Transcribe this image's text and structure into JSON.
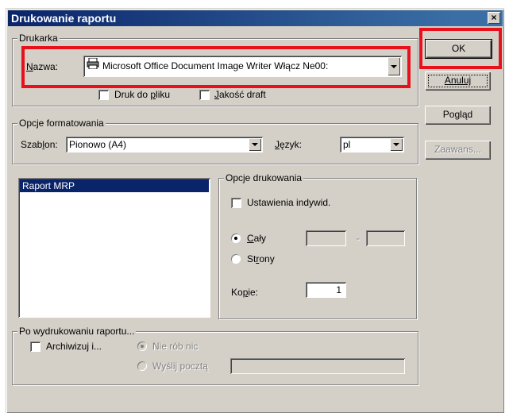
{
  "dialog": {
    "title": "Drukowanie raportu",
    "close_label": "×"
  },
  "printer_group": {
    "legend": "Drukarka",
    "name_label_prefix": "N",
    "name_label_rest": "azwa:",
    "printer_value": "Microsoft Office Document Image Writer Włącz Ne00:",
    "print_to_file_prefix": "Druk do ",
    "print_to_file_hot": "p",
    "print_to_file_rest": "liku",
    "draft_hot": "J",
    "draft_rest": "akość draft"
  },
  "format_group": {
    "legend": "Opcje formatowania",
    "template_label_prefix": "Szab",
    "template_label_hot": "l",
    "template_label_rest": "on:",
    "template_value": "Pionowo (A4)",
    "language_hot": "J",
    "language_rest": "ęzyk:",
    "language_value": "pl"
  },
  "report_list": {
    "items": [
      "Raport MRP"
    ]
  },
  "print_options": {
    "legend": "Opcje drukowania",
    "custom_settings_label": "Ustawienia indywid.",
    "all_hot": "C",
    "all_rest": "ały",
    "pages_prefix": "St",
    "pages_hot": "r",
    "pages_rest": "ony",
    "range_separator": "-",
    "copies_prefix": "Ko",
    "copies_hot": "p",
    "copies_rest": "ie:",
    "copies_value": "1"
  },
  "after_print": {
    "legend": "Po wydrukowaniu raportu...",
    "archive_label": "Archiwizuj i...",
    "do_nothing_label": "Nie rób nic",
    "send_mail_label": "Wyślij pocztą"
  },
  "buttons": {
    "ok": "OK",
    "cancel": "Anuluj",
    "preview_prefix": "Po",
    "preview_hot": "g",
    "preview_rest": "ląd",
    "advanced": "Zaawans..."
  },
  "colors": {
    "highlight": "#e8101b",
    "dialog_bg": "#d4d0c8",
    "title_bg": "#0a246a"
  }
}
